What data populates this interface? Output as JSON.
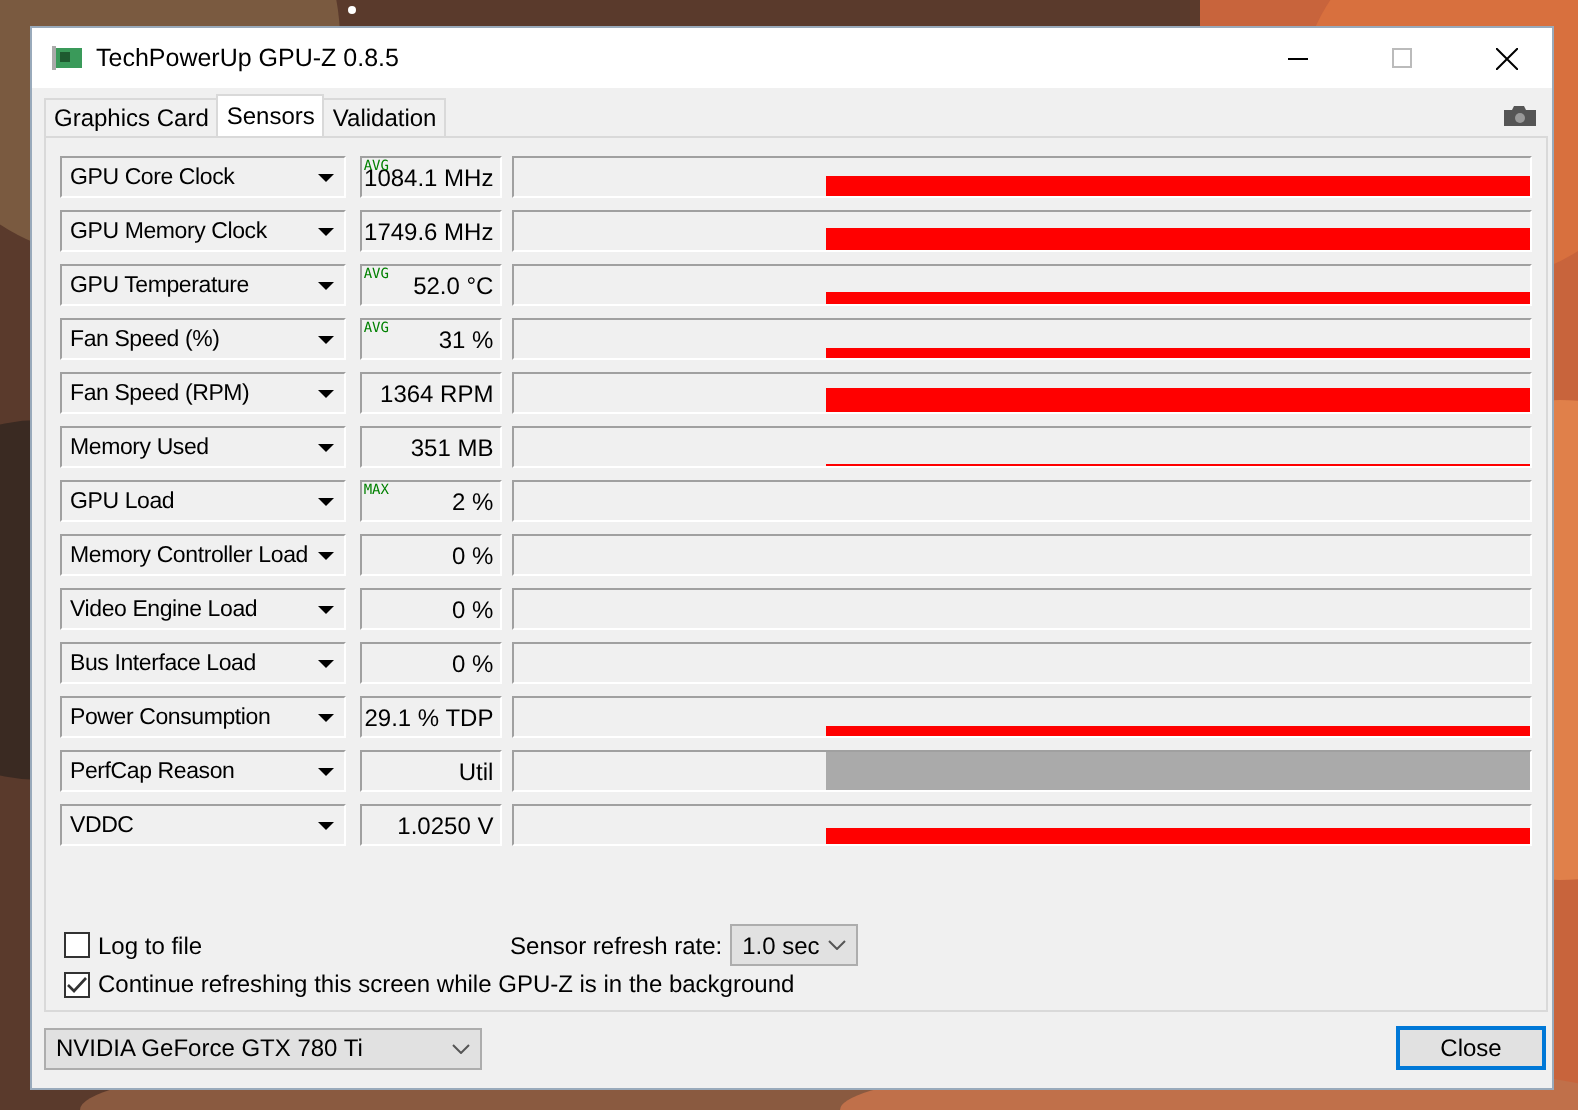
{
  "window": {
    "title": "TechPowerUp GPU-Z 0.8.5"
  },
  "tabs": [
    {
      "label": "Graphics Card",
      "selected": false
    },
    {
      "label": "Sensors",
      "selected": true
    },
    {
      "label": "Validation",
      "selected": false
    }
  ],
  "sensors": [
    {
      "name": "GPU Core Clock",
      "badge": "AVG",
      "reading": "1084.1 MHz"
    },
    {
      "name": "GPU Memory Clock",
      "reading": "1749.6 MHz"
    },
    {
      "name": "GPU Temperature",
      "badge": "AVG",
      "reading": "52.0 °C"
    },
    {
      "name": "Fan Speed (%)",
      "badge": "AVG",
      "reading": "31 %"
    },
    {
      "name": "Fan Speed (RPM)",
      "reading": "1364 RPM"
    },
    {
      "name": "Memory Used",
      "reading": "351 MB"
    },
    {
      "name": "GPU Load",
      "badge": "MAX",
      "reading": "2 %"
    },
    {
      "name": "Memory Controller Load",
      "reading": "0 %"
    },
    {
      "name": "Video Engine Load",
      "reading": "0 %"
    },
    {
      "name": "Bus Interface Load",
      "reading": "0 %"
    },
    {
      "name": "Power Consumption",
      "reading": "29.1 % TDP"
    },
    {
      "name": "PerfCap Reason",
      "reading": "Util"
    },
    {
      "name": "VDDC",
      "reading": "1.0250 V"
    }
  ],
  "log_to_file": {
    "label": "Log to file",
    "checked": false
  },
  "refresh_rate": {
    "label": "Sensor refresh rate:",
    "value": "1.0 sec"
  },
  "continue_refreshing": {
    "label": "Continue refreshing this screen while GPU-Z is in the background",
    "checked": true
  },
  "device": {
    "value": "NVIDIA GeForce GTX 780 Ti"
  },
  "close_button": {
    "label": "Close"
  }
}
